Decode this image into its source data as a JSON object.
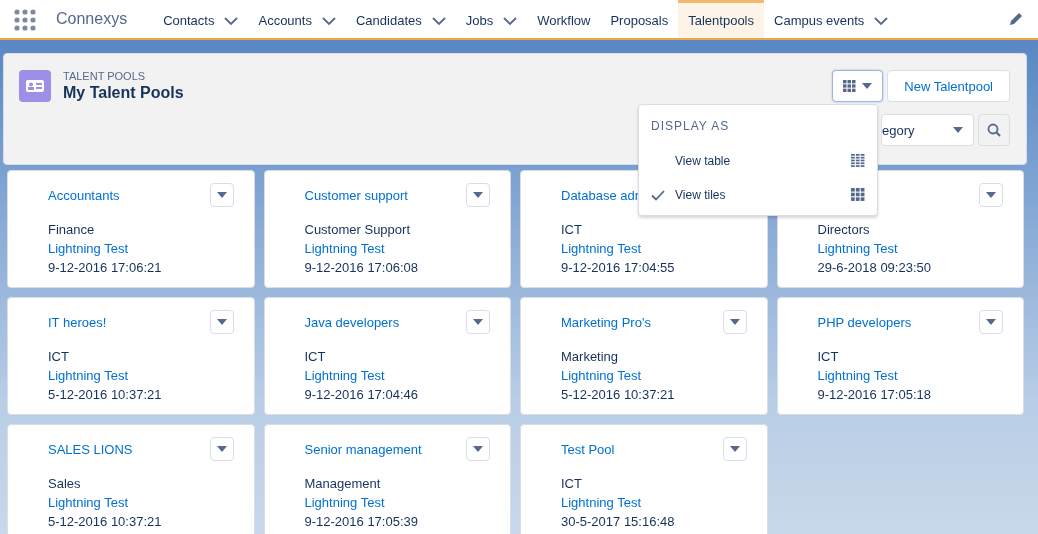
{
  "app": {
    "name": "Connexys"
  },
  "nav": [
    {
      "label": "Contacts",
      "menu": true,
      "selected": false
    },
    {
      "label": "Accounts",
      "menu": true,
      "selected": false
    },
    {
      "label": "Candidates",
      "menu": true,
      "selected": false
    },
    {
      "label": "Jobs",
      "menu": true,
      "selected": false
    },
    {
      "label": "Workflow",
      "menu": false,
      "selected": false
    },
    {
      "label": "Proposals",
      "menu": false,
      "selected": false
    },
    {
      "label": "Talentpools",
      "menu": false,
      "selected": true
    },
    {
      "label": "Campus events",
      "menu": true,
      "selected": false
    }
  ],
  "header": {
    "eyebrow": "TALENT POOLS",
    "title": "My Talent Pools",
    "new_button": "New Talentpool",
    "category_select": "egory"
  },
  "display_menu": {
    "heading": "DISPLAY AS",
    "items": [
      {
        "label": "View table",
        "selected": false,
        "kind": "table"
      },
      {
        "label": "View tiles",
        "selected": true,
        "kind": "tiles"
      }
    ]
  },
  "tiles": [
    {
      "name": "Accountants",
      "category": "Finance",
      "owner": "Lightning Test",
      "date": "9-12-2016 17:06:21"
    },
    {
      "name": "Customer support",
      "category": "Customer Support",
      "owner": "Lightning Test",
      "date": "9-12-2016 17:06:08"
    },
    {
      "name": "Database adr",
      "category": "ICT",
      "owner": "Lightning Test",
      "date": "9-12-2016 17:04:55"
    },
    {
      "category": "Directors",
      "owner": "Lightning Test",
      "date": "29-6-2018 09:23:50"
    },
    {
      "name": "IT heroes!",
      "category": "ICT",
      "owner": "Lightning Test",
      "date": "5-12-2016 10:37:21"
    },
    {
      "name": "Java developers",
      "category": "ICT",
      "owner": "Lightning Test",
      "date": "9-12-2016 17:04:46"
    },
    {
      "name": "Marketing Pro's",
      "category": "Marketing",
      "owner": "Lightning Test",
      "date": "5-12-2016 10:37:21"
    },
    {
      "name": "PHP developers",
      "category": "ICT",
      "owner": "Lightning Test",
      "date": "9-12-2016 17:05:18"
    },
    {
      "name": "SALES LIONS",
      "category": "Sales",
      "owner": "Lightning Test",
      "date": "5-12-2016 10:37:21"
    },
    {
      "name": "Senior management",
      "category": "Management",
      "owner": "Lightning Test",
      "date": "9-12-2016 17:05:39"
    },
    {
      "name": "Test Pool",
      "category": "ICT",
      "owner": "Lightning Test",
      "date": "30-5-2017 15:16:48"
    }
  ]
}
